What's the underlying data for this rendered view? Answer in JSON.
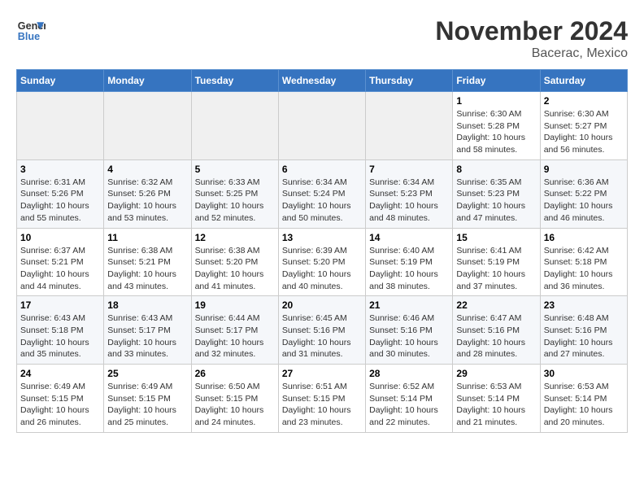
{
  "logo": {
    "line1": "General",
    "line2": "Blue"
  },
  "header": {
    "month": "November 2024",
    "location": "Bacerac, Mexico"
  },
  "weekdays": [
    "Sunday",
    "Monday",
    "Tuesday",
    "Wednesday",
    "Thursday",
    "Friday",
    "Saturday"
  ],
  "weeks": [
    [
      {
        "day": "",
        "info": ""
      },
      {
        "day": "",
        "info": ""
      },
      {
        "day": "",
        "info": ""
      },
      {
        "day": "",
        "info": ""
      },
      {
        "day": "",
        "info": ""
      },
      {
        "day": "1",
        "info": "Sunrise: 6:30 AM\nSunset: 5:28 PM\nDaylight: 10 hours and 58 minutes."
      },
      {
        "day": "2",
        "info": "Sunrise: 6:30 AM\nSunset: 5:27 PM\nDaylight: 10 hours and 56 minutes."
      }
    ],
    [
      {
        "day": "3",
        "info": "Sunrise: 6:31 AM\nSunset: 5:26 PM\nDaylight: 10 hours and 55 minutes."
      },
      {
        "day": "4",
        "info": "Sunrise: 6:32 AM\nSunset: 5:26 PM\nDaylight: 10 hours and 53 minutes."
      },
      {
        "day": "5",
        "info": "Sunrise: 6:33 AM\nSunset: 5:25 PM\nDaylight: 10 hours and 52 minutes."
      },
      {
        "day": "6",
        "info": "Sunrise: 6:34 AM\nSunset: 5:24 PM\nDaylight: 10 hours and 50 minutes."
      },
      {
        "day": "7",
        "info": "Sunrise: 6:34 AM\nSunset: 5:23 PM\nDaylight: 10 hours and 48 minutes."
      },
      {
        "day": "8",
        "info": "Sunrise: 6:35 AM\nSunset: 5:23 PM\nDaylight: 10 hours and 47 minutes."
      },
      {
        "day": "9",
        "info": "Sunrise: 6:36 AM\nSunset: 5:22 PM\nDaylight: 10 hours and 46 minutes."
      }
    ],
    [
      {
        "day": "10",
        "info": "Sunrise: 6:37 AM\nSunset: 5:21 PM\nDaylight: 10 hours and 44 minutes."
      },
      {
        "day": "11",
        "info": "Sunrise: 6:38 AM\nSunset: 5:21 PM\nDaylight: 10 hours and 43 minutes."
      },
      {
        "day": "12",
        "info": "Sunrise: 6:38 AM\nSunset: 5:20 PM\nDaylight: 10 hours and 41 minutes."
      },
      {
        "day": "13",
        "info": "Sunrise: 6:39 AM\nSunset: 5:20 PM\nDaylight: 10 hours and 40 minutes."
      },
      {
        "day": "14",
        "info": "Sunrise: 6:40 AM\nSunset: 5:19 PM\nDaylight: 10 hours and 38 minutes."
      },
      {
        "day": "15",
        "info": "Sunrise: 6:41 AM\nSunset: 5:19 PM\nDaylight: 10 hours and 37 minutes."
      },
      {
        "day": "16",
        "info": "Sunrise: 6:42 AM\nSunset: 5:18 PM\nDaylight: 10 hours and 36 minutes."
      }
    ],
    [
      {
        "day": "17",
        "info": "Sunrise: 6:43 AM\nSunset: 5:18 PM\nDaylight: 10 hours and 35 minutes."
      },
      {
        "day": "18",
        "info": "Sunrise: 6:43 AM\nSunset: 5:17 PM\nDaylight: 10 hours and 33 minutes."
      },
      {
        "day": "19",
        "info": "Sunrise: 6:44 AM\nSunset: 5:17 PM\nDaylight: 10 hours and 32 minutes."
      },
      {
        "day": "20",
        "info": "Sunrise: 6:45 AM\nSunset: 5:16 PM\nDaylight: 10 hours and 31 minutes."
      },
      {
        "day": "21",
        "info": "Sunrise: 6:46 AM\nSunset: 5:16 PM\nDaylight: 10 hours and 30 minutes."
      },
      {
        "day": "22",
        "info": "Sunrise: 6:47 AM\nSunset: 5:16 PM\nDaylight: 10 hours and 28 minutes."
      },
      {
        "day": "23",
        "info": "Sunrise: 6:48 AM\nSunset: 5:16 PM\nDaylight: 10 hours and 27 minutes."
      }
    ],
    [
      {
        "day": "24",
        "info": "Sunrise: 6:49 AM\nSunset: 5:15 PM\nDaylight: 10 hours and 26 minutes."
      },
      {
        "day": "25",
        "info": "Sunrise: 6:49 AM\nSunset: 5:15 PM\nDaylight: 10 hours and 25 minutes."
      },
      {
        "day": "26",
        "info": "Sunrise: 6:50 AM\nSunset: 5:15 PM\nDaylight: 10 hours and 24 minutes."
      },
      {
        "day": "27",
        "info": "Sunrise: 6:51 AM\nSunset: 5:15 PM\nDaylight: 10 hours and 23 minutes."
      },
      {
        "day": "28",
        "info": "Sunrise: 6:52 AM\nSunset: 5:14 PM\nDaylight: 10 hours and 22 minutes."
      },
      {
        "day": "29",
        "info": "Sunrise: 6:53 AM\nSunset: 5:14 PM\nDaylight: 10 hours and 21 minutes."
      },
      {
        "day": "30",
        "info": "Sunrise: 6:53 AM\nSunset: 5:14 PM\nDaylight: 10 hours and 20 minutes."
      }
    ]
  ]
}
